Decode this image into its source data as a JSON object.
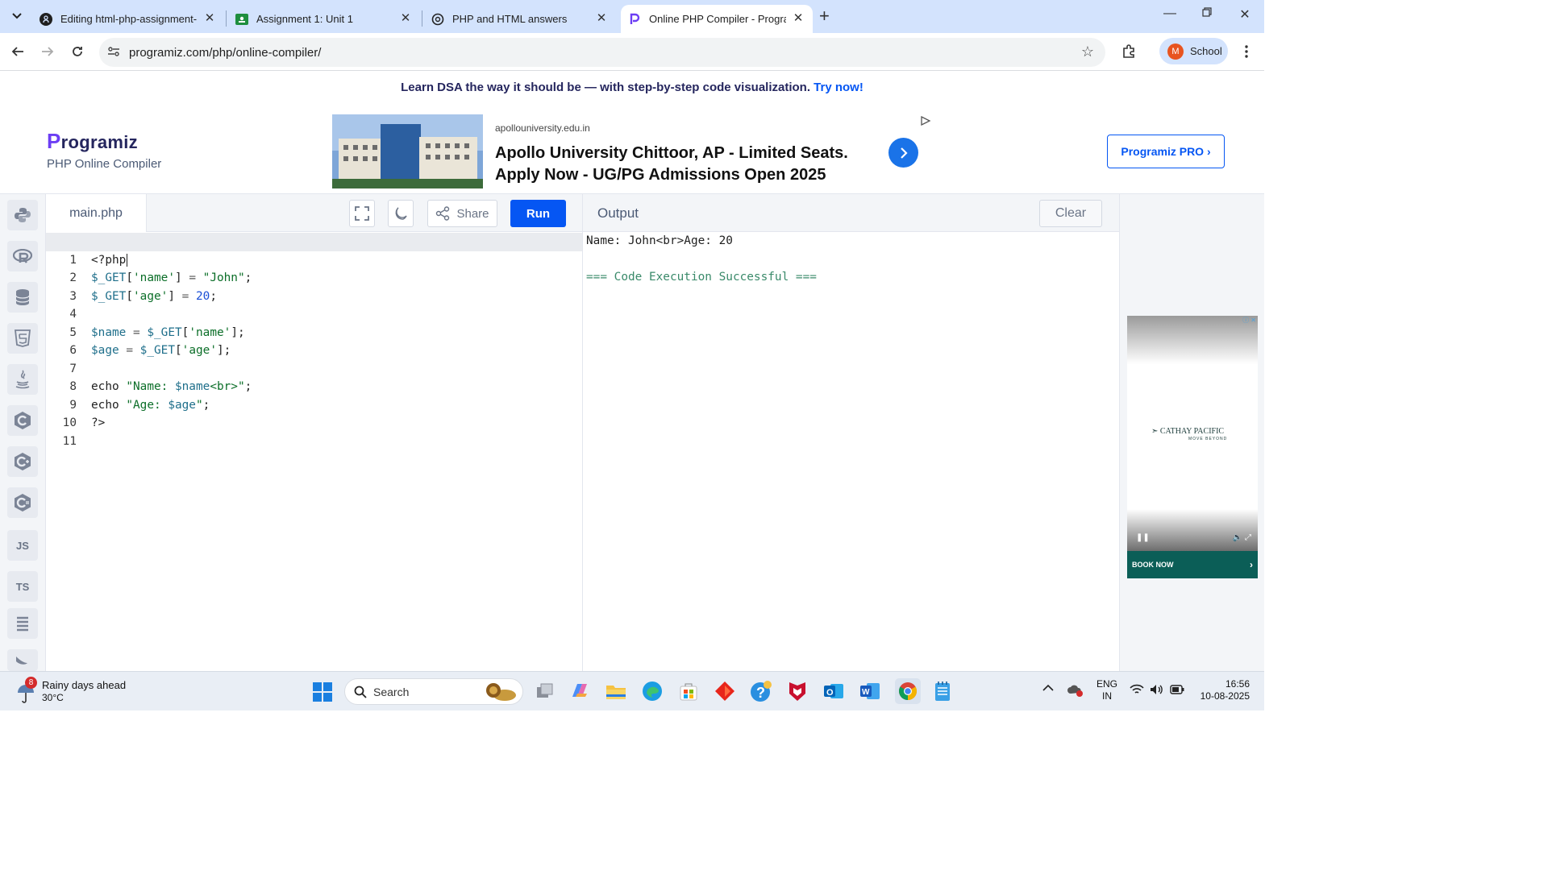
{
  "browser": {
    "tabs": [
      {
        "title": "Editing html-php-assignment-",
        "icon": "github-icon"
      },
      {
        "title": "Assignment 1: Unit 1",
        "icon": "classroom-icon"
      },
      {
        "title": "PHP and HTML answers",
        "icon": "chatgpt-icon"
      },
      {
        "title": "Online PHP Compiler - Program",
        "icon": "programiz-icon",
        "active": true
      }
    ],
    "url": "programiz.com/php/online-compiler/",
    "profile_initial": "M",
    "profile_name": "School"
  },
  "page": {
    "promo_text": "Learn DSA the way it should be — with step-by-step code visualization.",
    "promo_link": "Try now!",
    "logo_brand": "rogramiz",
    "logo_brand_p": "P",
    "logo_sub": "PHP Online Compiler",
    "pro_button": "Programiz PRO ›",
    "ad": {
      "domain": "apollouniversity.edu.in",
      "headline": "Apollo University Chittoor, AP - Limited Seats. Apply Now - UG/PG Admissions Open 2025"
    },
    "languages": [
      "python-icon",
      "r-icon",
      "sql-icon",
      "html-icon",
      "java-icon",
      "c-icon",
      "cpp-icon",
      "csharp-icon",
      "JS",
      "TS",
      "go-icon",
      "swift-icon"
    ],
    "editor": {
      "filename": "main.php",
      "share_label": "Share",
      "run_label": "Run"
    },
    "output": {
      "title": "Output",
      "clear_label": "Clear",
      "lines": [
        "Name: John<br>Age: 20",
        "",
        "=== Code Execution Successful ==="
      ]
    },
    "side_ad": {
      "brand": "CATHAY PACIFIC",
      "tagline": "MOVE BEYOND",
      "cta": "BOOK NOW"
    }
  },
  "taskbar": {
    "weather_badge": "8",
    "weather_title": "Rainy days ahead",
    "weather_temp": "30°C",
    "search_label": "Search",
    "lang_top": "ENG",
    "lang_bottom": "IN",
    "time": "16:56",
    "date": "10-08-2025"
  },
  "colors": {
    "accent": "#0556f3",
    "tabstrip": "#d3e3fd",
    "brand_purple": "#6c3ef4"
  }
}
